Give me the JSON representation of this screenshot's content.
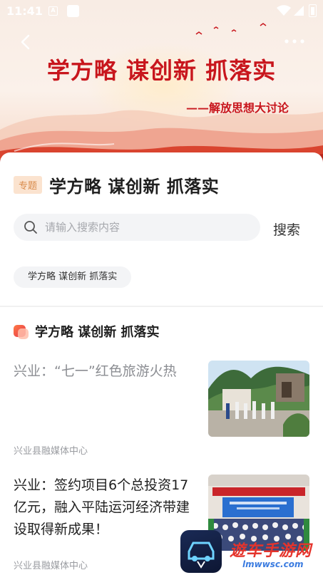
{
  "status_bar": {
    "time": "11:41",
    "notif_icon_letter": "A"
  },
  "banner": {
    "headline": "学方略 谋创新 抓落实",
    "subtitle": "——解放思想大讨论"
  },
  "topic": {
    "tag": "专题",
    "title": "学方略 谋创新 抓落实"
  },
  "search": {
    "placeholder": "请输入搜索内容",
    "button_label": "搜索"
  },
  "filter_chip": "学方略 谋创新 抓落实",
  "section": {
    "title": "学方略 谋创新 抓落实"
  },
  "news": [
    {
      "title": "兴业：“七一”红色旅游火热",
      "source": "兴业县融媒体中心",
      "read": true
    },
    {
      "title": "兴业：签约项目6个总投资17亿元，融入平陆运河经济带建设取得新成果！",
      "source": "兴业县融媒体中心",
      "read": false
    }
  ],
  "watermark": {
    "text": "遊车手游网",
    "url": "lmwwsc.com"
  },
  "colors": {
    "accent_red": "#c8161d",
    "tag_bg": "#fbe3cf",
    "tag_text": "#d98a4a"
  }
}
